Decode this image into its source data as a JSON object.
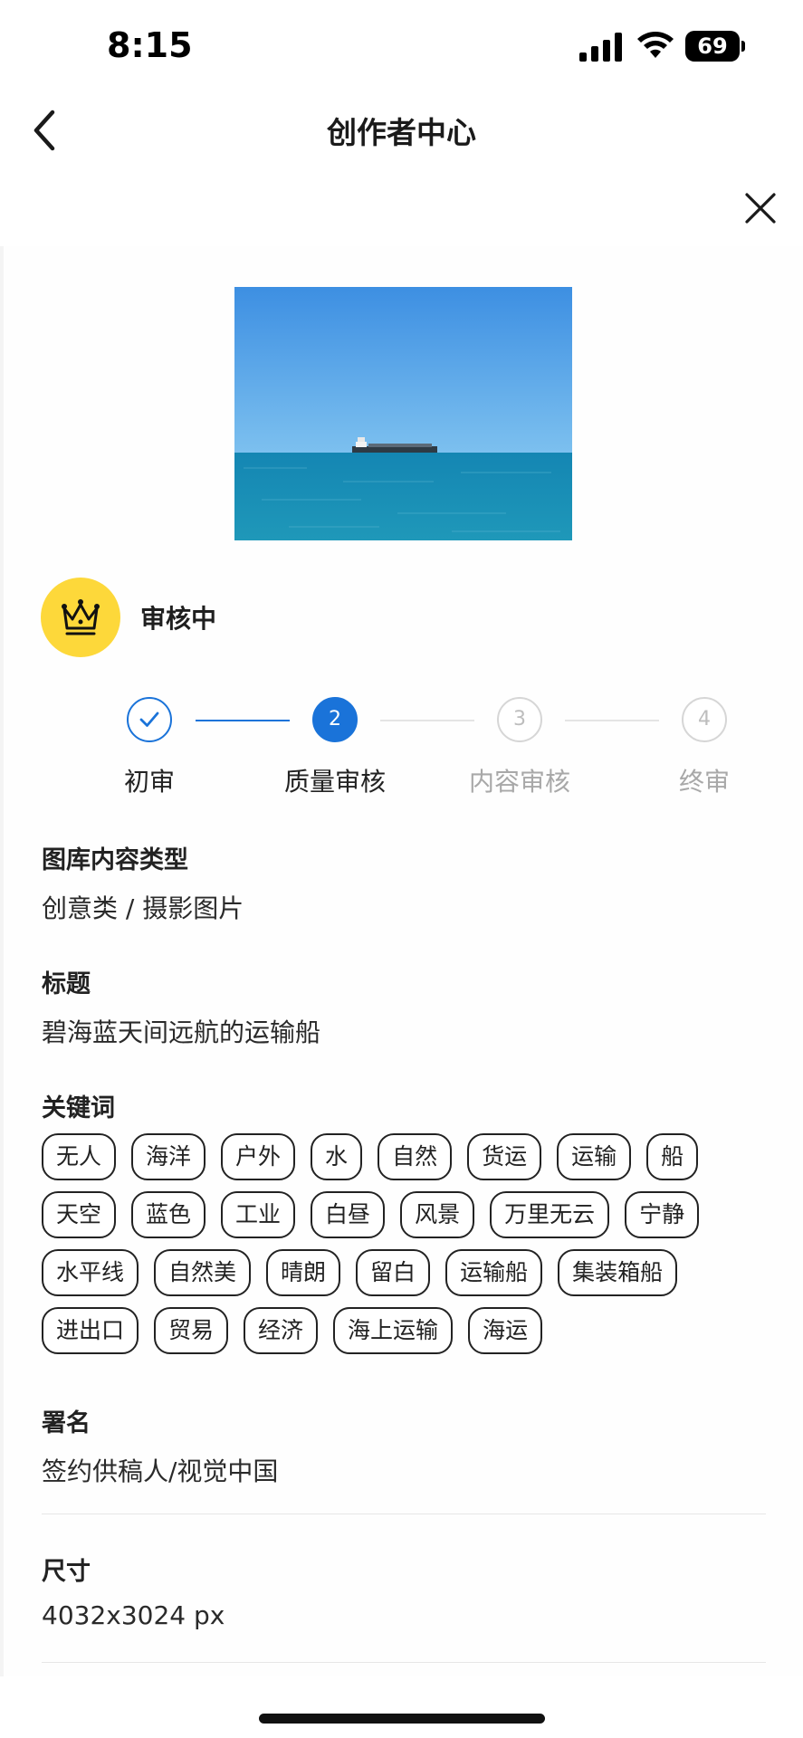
{
  "status_bar": {
    "time": "8:15",
    "battery": "69"
  },
  "nav": {
    "title": "创作者中心"
  },
  "review": {
    "status": "审核中",
    "steps": [
      {
        "number": "1",
        "label": "初审",
        "state": "done"
      },
      {
        "number": "2",
        "label": "质量审核",
        "state": "active"
      },
      {
        "number": "3",
        "label": "内容审核",
        "state": "pending"
      },
      {
        "number": "4",
        "label": "终审",
        "state": "pending"
      }
    ]
  },
  "details": {
    "content_type": {
      "title": "图库内容类型",
      "value": "创意类 / 摄影图片"
    },
    "headline": {
      "title": "标题",
      "value": "碧海蓝天间远航的运输船"
    },
    "keywords": {
      "title": "关键词",
      "rows": [
        [
          "无人",
          "海洋",
          "户外",
          "水",
          "自然",
          "货运",
          "运输",
          "船"
        ],
        [
          "天空",
          "蓝色",
          "工业",
          "白昼",
          "风景",
          "万里无云",
          "宁静"
        ],
        [
          "水平线",
          "自然美",
          "晴朗",
          "留白",
          "运输船",
          "集装箱船"
        ],
        [
          "进出口",
          "贸易",
          "经济",
          "海上运输",
          "海运"
        ]
      ]
    },
    "signature": {
      "title": "署名",
      "value": "签约供稿人/视觉中国"
    },
    "size": {
      "title": "尺寸",
      "value": "4032x3024 px"
    }
  },
  "colors": {
    "accent": "#1a73d9",
    "crown_bg": "#fdd83a",
    "pending": "#d6d6d6"
  }
}
